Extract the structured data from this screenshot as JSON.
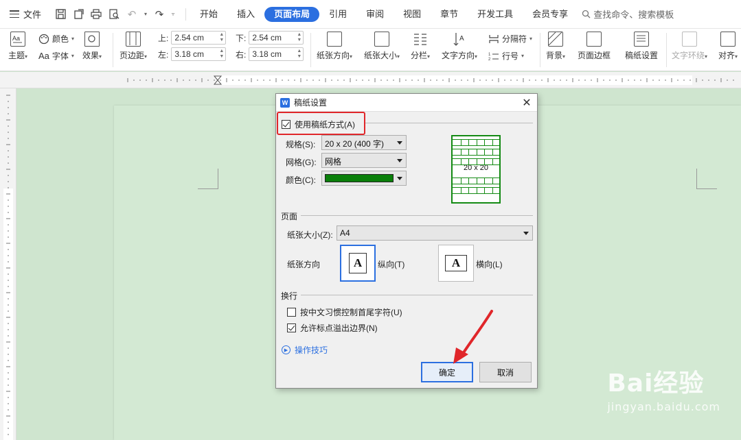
{
  "menubar": {
    "file_label": "文件",
    "tabs": [
      {
        "label": "开始"
      },
      {
        "label": "插入"
      },
      {
        "label": "页面布局",
        "active": true
      },
      {
        "label": "引用"
      },
      {
        "label": "审阅"
      },
      {
        "label": "视图"
      },
      {
        "label": "章节"
      },
      {
        "label": "开发工具"
      },
      {
        "label": "会员专享"
      }
    ],
    "search_label": "查找命令、搜索模板"
  },
  "ribbon": {
    "theme_label": "主题",
    "color_label": "颜色",
    "font_label": "字体",
    "font_prefix": "Aa",
    "effect_label": "效果",
    "margins_label": "页边距",
    "top_label": "上:",
    "top_value": "2.54 cm",
    "bottom_label": "下:",
    "bottom_value": "2.54 cm",
    "left_label": "左:",
    "left_value": "3.18 cm",
    "right_label": "右:",
    "right_value": "3.18 cm",
    "orientation_label": "纸张方向",
    "size_label": "纸张大小",
    "columns_label": "分栏",
    "text_direction_label": "文字方向",
    "break_label": "分隔符",
    "line_number_label": "行号",
    "background_label": "背景",
    "page_border_label": "页面边框",
    "manuscript_label": "稿纸设置",
    "text_wrap_label": "文字环绕",
    "align_label": "对齐"
  },
  "dialog": {
    "title": "稿纸设置",
    "app_icon": "W",
    "use_manuscript_label": "使用稿纸方式(A)",
    "use_manuscript_checked": true,
    "spec_label": "规格(S):",
    "spec_value": "20 x 20 (400 字)",
    "grid_label": "网格(G):",
    "grid_value": "网格",
    "color_label": "颜色(C):",
    "color_value": "#0a7f0a",
    "preview_text": "20 x 20",
    "page_section": "页面",
    "paper_size_label": "纸张大小(Z):",
    "paper_size_value": "A4",
    "orientation_label": "纸张方向",
    "portrait_label": "纵向(T)",
    "landscape_label": "横向(L)",
    "portrait_selected": true,
    "wrap_section": "换行",
    "chinese_control_label": "按中文习惯控制首尾字符(U)",
    "chinese_control_checked": false,
    "punct_overflow_label": "允许标点溢出边界(N)",
    "punct_overflow_checked": true,
    "tips_label": "操作技巧",
    "ok_label": "确定",
    "cancel_label": "取消"
  },
  "watermark": {
    "brand": "Bai经验",
    "url": "jingyan.baidu.com"
  },
  "colors": {
    "accent": "#2b6fe0",
    "highlight": "#e0262a",
    "doc_bg": "#cfe5cf",
    "grid_green": "#138a13"
  }
}
